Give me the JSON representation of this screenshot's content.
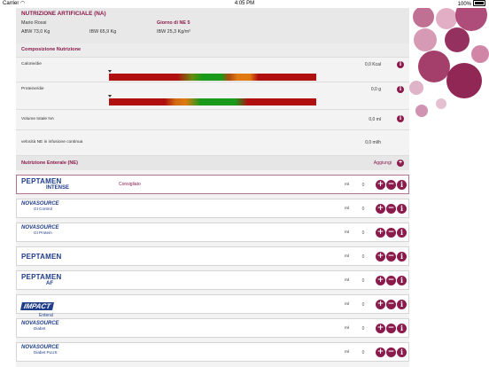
{
  "status": {
    "carrier": "Carrier",
    "time": "4:05 PM",
    "battery": "100%"
  },
  "header": {
    "title": "NUTRIZIONE ARTIFICIALE (NA)",
    "patient_name": "Mario Rossi",
    "day": "Giorno di NE 5",
    "abw": "ABW 73,0 Kg",
    "ibw": "IBW 65,9 Kg",
    "bmi": "IBW 25,3 Kg/m²"
  },
  "composition": {
    "title": "Composizione Nutrizione",
    "rows": [
      {
        "label": "Calorie/die",
        "value": "0,0 Kcal"
      },
      {
        "label": "Proteine/die",
        "value": "0,0 g"
      },
      {
        "label": "Volume totale NA",
        "value": "0,0 ml"
      },
      {
        "label": "velocità NE in infusione continua",
        "value": "0,0 ml/h"
      }
    ]
  },
  "enteral": {
    "title": "Nutrizione Enterale (NE)",
    "add_label": "Aggiungi",
    "recommended_label": "Consigliato",
    "unit": "ml",
    "products": [
      {
        "brand": "PEPTAMEN",
        "sub": "INTENSE",
        "style": "peptamen",
        "qty": "0",
        "selected": true
      },
      {
        "brand": "NOVASOURCE",
        "sub": "GI Control",
        "style": "novasource",
        "qty": "0",
        "selected": false
      },
      {
        "brand": "NOVASOURCE",
        "sub": "GI Protein",
        "style": "novasource",
        "qty": "0",
        "selected": false
      },
      {
        "brand": "PEPTAMEN",
        "sub": "",
        "style": "peptamen",
        "qty": "0",
        "selected": false
      },
      {
        "brand": "PEPTAMEN",
        "sub": "AF",
        "style": "peptamen",
        "qty": "0",
        "selected": false
      },
      {
        "brand": "IMPACT",
        "sub": "Enteral",
        "style": "impact",
        "qty": "0",
        "selected": false
      },
      {
        "brand": "NOVASOURCE",
        "sub": "Diabet",
        "style": "novasource",
        "qty": "0",
        "selected": false
      },
      {
        "brand": "NOVASOURCE",
        "sub": "Diabet PLUS",
        "style": "novasource",
        "qty": "0",
        "selected": false
      }
    ]
  },
  "colors": {
    "accent": "#8a1b4c",
    "bar_red": "#b01010",
    "bar_green": "#1a9a1a",
    "bar_orange": "#e07a10"
  }
}
